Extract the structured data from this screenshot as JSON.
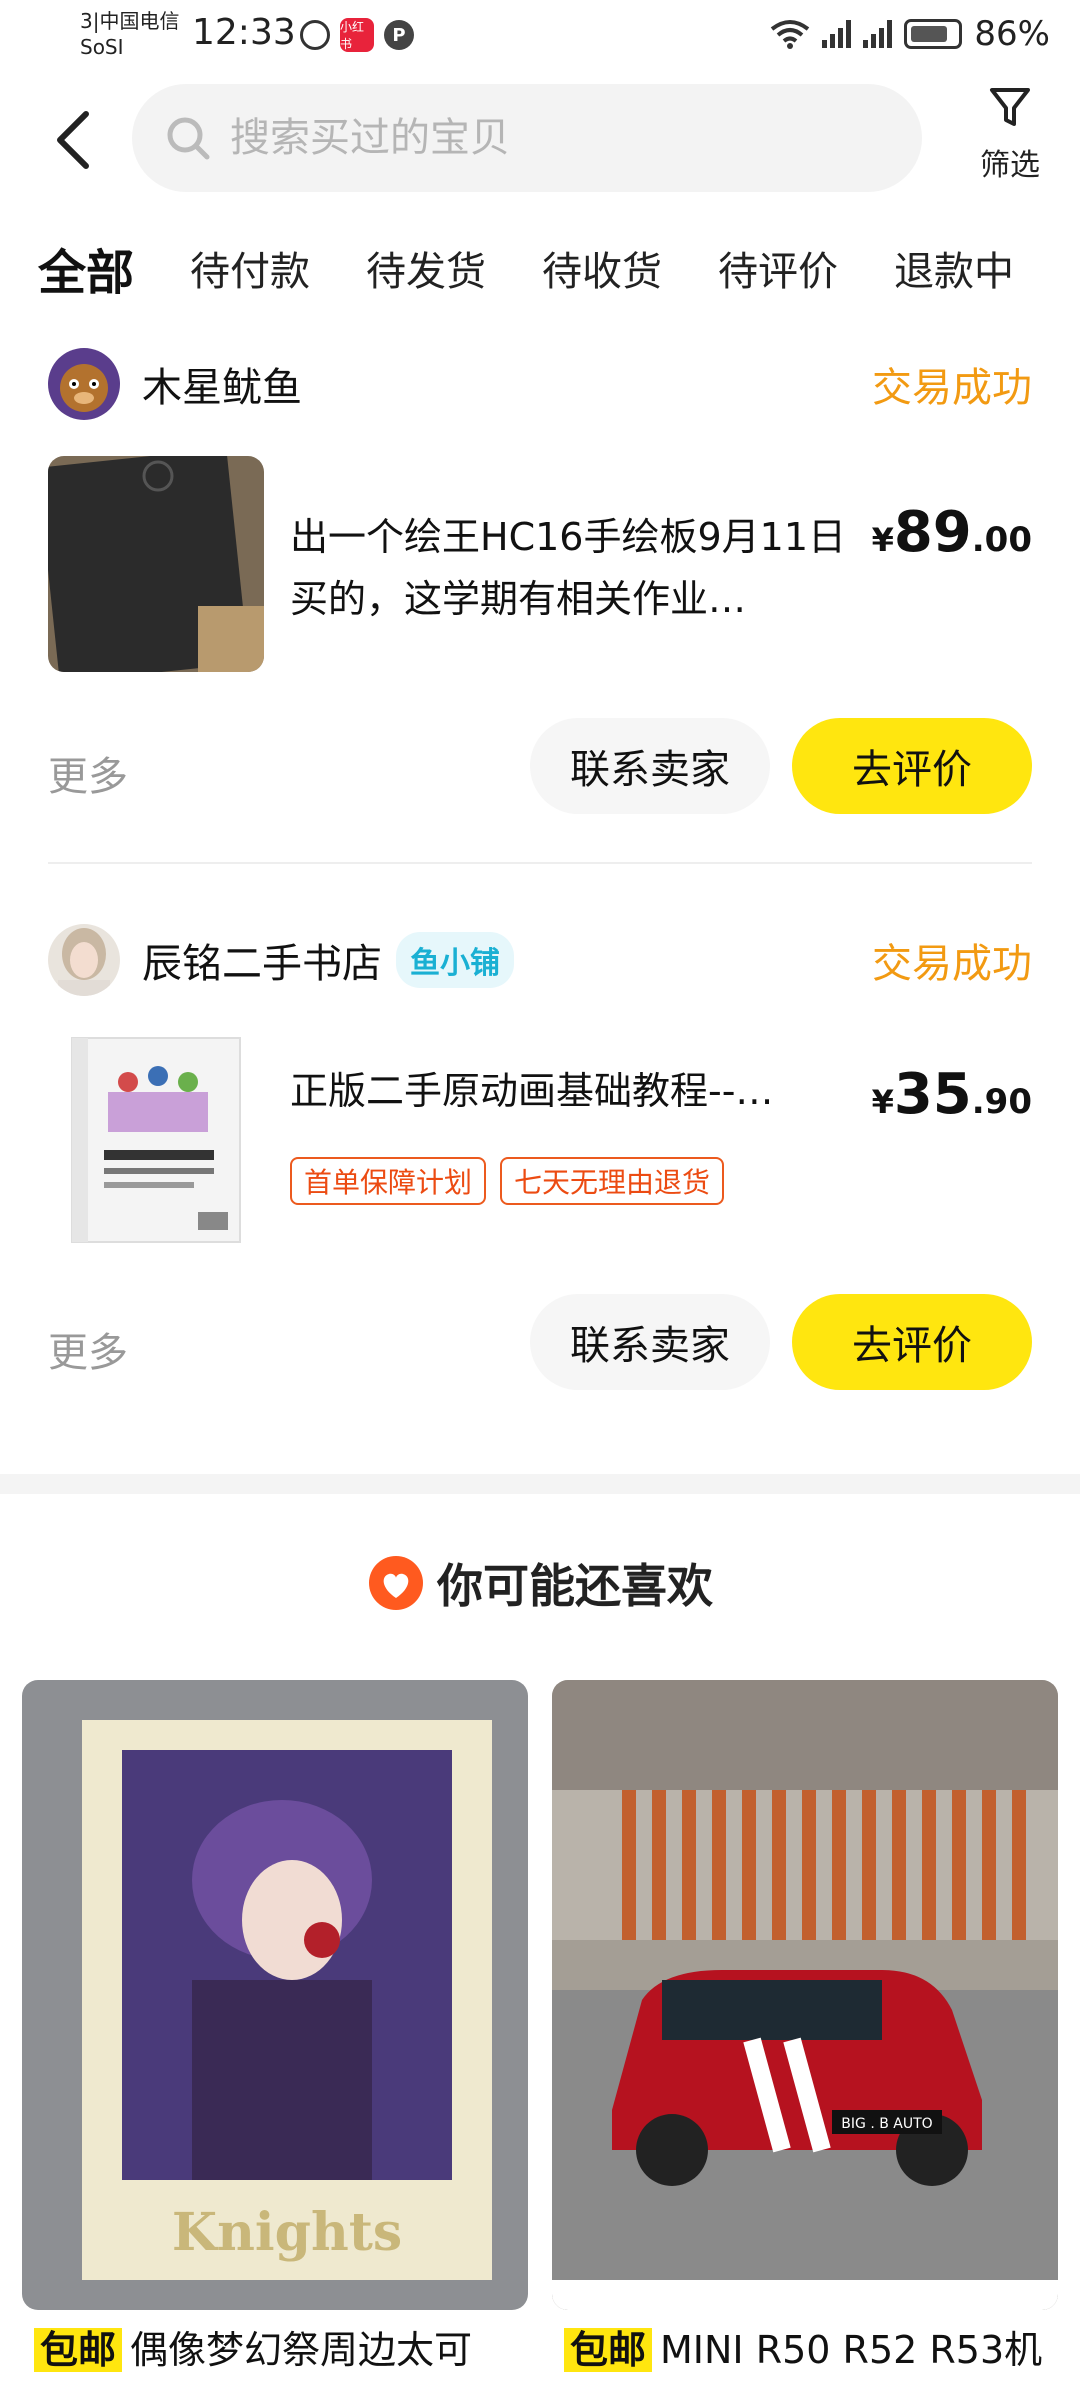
{
  "status_bar": {
    "carrier_line1": "3|中国电信",
    "carrier_line2": "SoSI",
    "time": "12:33",
    "app_badge": "小红书",
    "battery": "86%"
  },
  "header": {
    "search_placeholder": "搜索买过的宝贝",
    "filter_label": "筛选"
  },
  "tabs": [
    "全部",
    "待付款",
    "待发货",
    "待收货",
    "待评价",
    "退款中"
  ],
  "orders": [
    {
      "seller": "木星鱿鱼",
      "status": "交易成功",
      "title": "出一个绘王HC16手绘板9月11日买的，这学期有相关作业…",
      "price_symbol": "¥",
      "price_int": "89",
      "price_dec": ".00",
      "more": "更多",
      "contact_button": "联系卖家",
      "review_button": "去评价"
    },
    {
      "seller": "辰铭二手书店",
      "shop_badge": "鱼小铺",
      "status": "交易成功",
      "title": "正版二手原动画基础教程--…",
      "tags": [
        "首单保障计划",
        "七天无理由退货"
      ],
      "price_symbol": "¥",
      "price_int": "35",
      "price_dec": ".90",
      "more": "更多",
      "contact_button": "联系卖家",
      "review_button": "去评价"
    }
  ],
  "recommend": {
    "heading": "你可能还喜欢",
    "items": [
      {
        "badge": "包邮",
        "title": "偶像梦幻祭周边太可",
        "image_text": "Knights"
      },
      {
        "badge": "包邮",
        "title": "MINI R50 R52 R53机",
        "image_text": "BIG . B AUTO"
      }
    ]
  },
  "colors": {
    "accent_yellow": "#ffe60f",
    "status_orange": "#f29a12",
    "tag_red": "#ec4b12",
    "shop_badge_blue": "#1ab0d3"
  }
}
